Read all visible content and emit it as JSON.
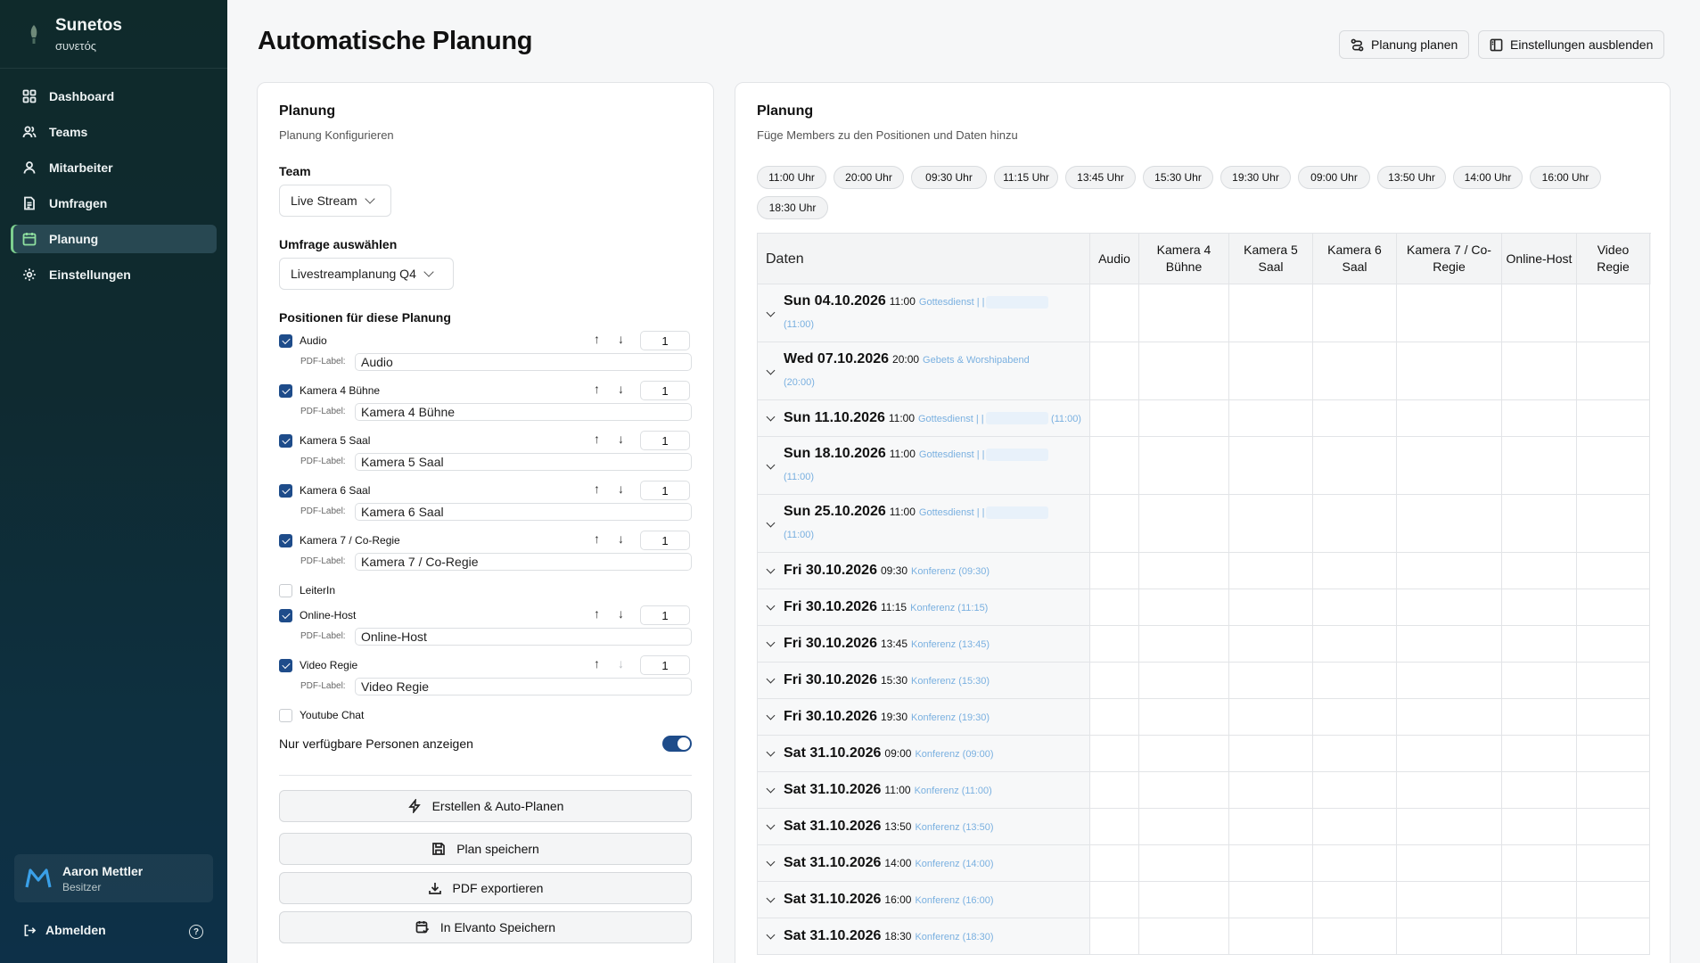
{
  "sidebar": {
    "brand_title": "Sunetos",
    "brand_sub": "συνετός",
    "items": [
      {
        "label": "Dashboard",
        "icon": "grid-icon"
      },
      {
        "label": "Teams",
        "icon": "users-icon"
      },
      {
        "label": "Mitarbeiter",
        "icon": "user-icon"
      },
      {
        "label": "Umfragen",
        "icon": "document-icon"
      },
      {
        "label": "Planung",
        "icon": "calendar-icon",
        "active": true
      },
      {
        "label": "Einstellungen",
        "icon": "gear-icon"
      }
    ],
    "user": {
      "name": "Aaron Mettler",
      "role": "Besitzer"
    },
    "logout_label": "Abmelden",
    "help_glyph": "?"
  },
  "header": {
    "title": "Automatische Planung",
    "plan_button": "Planung planen",
    "hide_settings_button": "Einstellungen ausblenden"
  },
  "config": {
    "title": "Planung",
    "subtitle": "Planung Konfigurieren",
    "team_label": "Team",
    "team_value": "Live Stream",
    "survey_label": "Umfrage auswählen",
    "survey_value": "Livestreamplanung Q4",
    "positions_label": "Positionen für diese Planung",
    "pdf_label_text": "PDF-Label:",
    "positions": [
      {
        "name": "Audio",
        "checked": true,
        "count": "1",
        "pdf": "Audio"
      },
      {
        "name": "Kamera 4 Bühne",
        "checked": true,
        "count": "1",
        "pdf": "Kamera 4 Bühne"
      },
      {
        "name": "Kamera 5 Saal",
        "checked": true,
        "count": "1",
        "pdf": "Kamera 5 Saal"
      },
      {
        "name": "Kamera 6 Saal",
        "checked": true,
        "count": "1",
        "pdf": "Kamera 6 Saal"
      },
      {
        "name": "Kamera 7 / Co-Regie",
        "checked": true,
        "count": "1",
        "pdf": "Kamera 7 / Co-Regie"
      },
      {
        "name": "LeiterIn",
        "checked": false
      },
      {
        "name": "Online-Host",
        "checked": true,
        "count": "1",
        "pdf": "Online-Host"
      },
      {
        "name": "Video Regie",
        "checked": true,
        "count": "1",
        "pdf": "Video Regie"
      },
      {
        "name": "Youtube Chat",
        "checked": false
      }
    ],
    "available_only_label": "Nur verfügbare Personen anzeigen",
    "available_only_on": true,
    "buttons": {
      "create": "Erstellen & Auto-Planen",
      "save": "Plan speichern",
      "pdf": "PDF exportieren",
      "elvanto": "In Elvanto Speichern"
    }
  },
  "planning": {
    "title": "Planung",
    "subtitle": "Füge Members zu den Positionen und Daten hinzu",
    "times": [
      "11:00 Uhr",
      "20:00 Uhr",
      "09:30 Uhr",
      "11:15 Uhr",
      "13:45 Uhr",
      "15:30 Uhr",
      "19:30 Uhr",
      "09:00 Uhr",
      "13:50 Uhr",
      "14:00 Uhr",
      "16:00 Uhr",
      "18:30 Uhr"
    ],
    "columns": [
      "Daten",
      "Audio",
      "Kamera 4 Bühne",
      "Kamera 5 Saal",
      "Kamera 6 Saal",
      "Kamera 7 / Co-Regie",
      "Online-Host",
      "Video Regie"
    ],
    "rows": [
      {
        "date": "Sun 04.10.2026",
        "time": "11:00",
        "event": "Gottesdienst | |",
        "suffix": "(11:00)"
      },
      {
        "date": "Wed 07.10.2026",
        "time": "20:00",
        "event": "Gebets & Worshipabend",
        "suffix": "(20:00)"
      },
      {
        "date": "Sun 11.10.2026",
        "time": "11:00",
        "event": "Gottesdienst | |",
        "suffix": "(11:00)"
      },
      {
        "date": "Sun 18.10.2026",
        "time": "11:00",
        "event": "Gottesdienst | |",
        "suffix": "(11:00)"
      },
      {
        "date": "Sun 25.10.2026",
        "time": "11:00",
        "event": "Gottesdienst | |",
        "suffix": "(11:00)"
      },
      {
        "date": "Fri 30.10.2026",
        "time": "09:30",
        "event": "Konferenz (09:30)"
      },
      {
        "date": "Fri 30.10.2026",
        "time": "11:15",
        "event": "Konferenz (11:15)"
      },
      {
        "date": "Fri 30.10.2026",
        "time": "13:45",
        "event": "Konferenz (13:45)"
      },
      {
        "date": "Fri 30.10.2026",
        "time": "15:30",
        "event": "Konferenz (15:30)"
      },
      {
        "date": "Fri 30.10.2026",
        "time": "19:30",
        "event": "Konferenz (19:30)"
      },
      {
        "date": "Sat 31.10.2026",
        "time": "09:00",
        "event": "Konferenz (09:00)"
      },
      {
        "date": "Sat 31.10.2026",
        "time": "11:00",
        "event": "Konferenz (11:00)"
      },
      {
        "date": "Sat 31.10.2026",
        "time": "13:50",
        "event": "Konferenz (13:50)"
      },
      {
        "date": "Sat 31.10.2026",
        "time": "14:00",
        "event": "Konferenz (14:00)"
      },
      {
        "date": "Sat 31.10.2026",
        "time": "16:00",
        "event": "Konferenz (16:00)"
      },
      {
        "date": "Sat 31.10.2026",
        "time": "18:30",
        "event": "Konferenz (18:30)"
      }
    ]
  }
}
